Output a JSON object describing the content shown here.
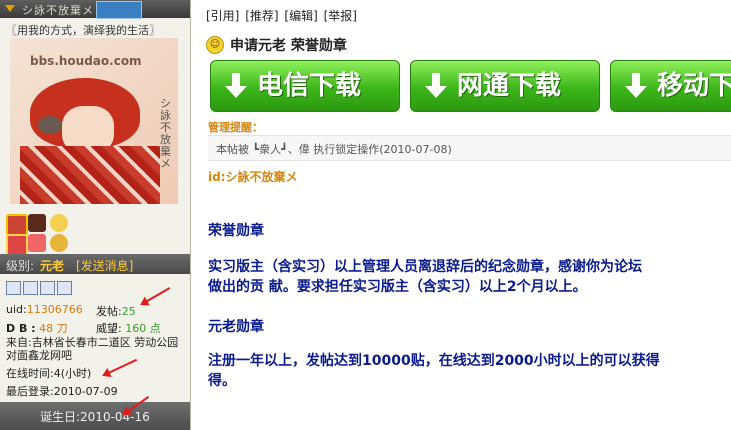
{
  "user": {
    "signature": "〖用我的方式，演绎我的生活〗",
    "avatar_url_text": "bbs.houdao.com",
    "level_label": "级别:",
    "level_title": "元老",
    "send_message": "[发送消息]",
    "uid_label": "uid:",
    "uid_value": "11306766",
    "posts_label": "发帖:",
    "posts_value": "25",
    "db_label": "D B :",
    "db_value": "48 刀",
    "prestige_label": "威望:",
    "prestige_value": "160 点",
    "from_text": "来自:吉林省长春市二道区 劳动公园对面鑫龙网吧",
    "online_time": "在线时间:4(小时)",
    "last_login": "最后登录:2010-07-09",
    "birthday": "诞生日:2010-04-16"
  },
  "post": {
    "toolbar": [
      "[引用]",
      "[推荐]",
      "[编辑]",
      "[举报]"
    ],
    "title": "申请元老 荣誉勋章",
    "download_buttons": [
      {
        "label": "电信下载",
        "color": "#3cb51a"
      },
      {
        "label": "网通下载",
        "color": "#3cb51a"
      },
      {
        "label": "移动下",
        "color": "#3cb51a"
      }
    ],
    "mgmt_label": "管理提醒：",
    "mgmt_text": "本帖被 ┗衆人┛、偉 执行锁定操作(2010-07-08)",
    "id_line": "id:シ詠不放棄メ",
    "content": {
      "h1": "荣誉勋章",
      "p1_line1": "实习版主（含实习）以上管理人员离退辞后的纪念勋章，感谢你为论坛",
      "p1_line2": "做出的贡 献。要求担任实习版主（含实习）以上2个月以上。",
      "h2": "元老勋章",
      "p2_line1": "注册一年以上，发帖达到10000贴，在线达到2000小时以上的可以获得",
      "p2_line2": "得。"
    }
  },
  "colors": {
    "accent_orange": "#d4860f",
    "content_blue": "#0a1b8a",
    "arrow_red": "#e21a1a",
    "button_green": "#3cb51a"
  }
}
